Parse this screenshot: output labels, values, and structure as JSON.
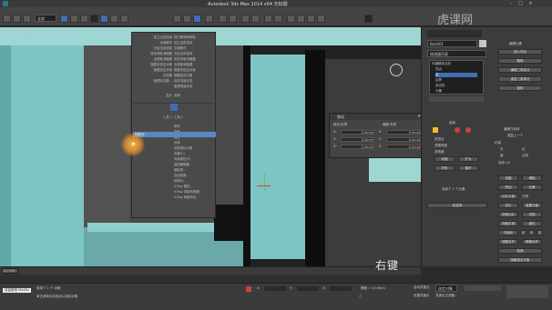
{
  "window": {
    "title": "Autodesk 3ds Max  2014 x64      无标题"
  },
  "toolbar": {
    "selection_filter": "全部"
  },
  "viewport": {
    "label": "[+] [透视] [真实]",
    "gizmo_labels": {
      "x": "x",
      "y": "y",
      "z": "z"
    }
  },
  "context_menu": {
    "top_items": [
      "孤立当前选择",
      "全部解冻",
      "冻结当前选择",
      "按名称取消隐藏",
      "全部取消隐藏",
      "隐藏未选定对象",
      "隐藏选定对象",
      "状态集",
      "管理状态集..."
    ],
    "left_items": [
      "显示",
      "变换",
      "工具 1",
      "工具 2"
    ],
    "right_items": [
      "视口照明和阴影",
      "孤立当前选择",
      "全部解冻",
      "冻结当前选择",
      "按名称取消隐藏",
      "全部取消隐藏",
      "隐藏未选定对象",
      "隐藏选定对象",
      "保存场景状态",
      "管理场景状态"
    ],
    "bottom_items": [
      "移动",
      "旋转",
      "缩放",
      "选择",
      "选择类似对象",
      "克隆(C)",
      "对象属性(P)",
      "曲线编辑器",
      "摄影表...",
      "连线参数...",
      "转换为:",
      "V-Ray 属性",
      "V-Ray 场景转换器",
      "V-Ray 网格导出"
    ],
    "highlighted": "转换为:"
  },
  "dialog": {
    "title": "移动",
    "group_absolute": "绝对:世界",
    "group_offset": "偏移:世界",
    "rows": [
      {
        "axis": "X:",
        "abs": "0.0mm",
        "off": "0.0mm"
      },
      {
        "axis": "Y:",
        "abs": "0.0mm",
        "off": "0.0mm"
      },
      {
        "axis": "Z:",
        "abs": "0.0mm",
        "off": "0.0mm"
      }
    ]
  },
  "command_panel": {
    "object_name": "Box001",
    "modifier_list": "修改器列表",
    "stack": [
      "可编辑多边形",
      "顶点",
      "边",
      "边界",
      "多边形",
      "元素"
    ],
    "selection_title": "选择",
    "soft_selection": "软选择",
    "edit_geometry": "编辑几何体",
    "checkboxes": [
      "按顶点",
      "忽略背面",
      "按角度:",
      "收缩",
      "扩大",
      "环形",
      "循环"
    ],
    "count_label": "选择了 1 个元素",
    "buttons_right": [
      "编辑元素",
      "插入顶点",
      "翻转",
      "编辑三角剖分",
      "重复三角算法",
      "旋转",
      "编辑几何体",
      "重复上一个",
      "约束",
      "无",
      "边",
      "面",
      "法线",
      "保持 UV",
      "创建",
      "塌陷",
      "附加",
      "分离",
      "切片平面",
      "分割",
      "切片",
      "重置平面",
      "快速切片",
      "切割",
      "网格平滑",
      "细化",
      "平面化",
      "X",
      "Y",
      "Z",
      "视图对齐",
      "栅格对齐",
      "松弛",
      "隐藏选定对象",
      "全部取消隐藏",
      "隐藏未选定对象",
      "命名选择:",
      "复制",
      "粘贴",
      "删除孤立顶点",
      "完全交互"
    ]
  },
  "timeline": {
    "frame": "0 / 100"
  },
  "status": {
    "prompt": "选择了 1 个 对象",
    "hint": "单击或单击并拖动以选择对象",
    "coords": {
      "x": "X:",
      "y": "Y:",
      "z": "Z:"
    },
    "grid": "栅格 = 10.0mm",
    "auto_key": "自动关键点",
    "set_key": "设置关键点",
    "selected_label": "选定对象",
    "key_filters": "关键点过滤器...",
    "welcome": "欢迎使用 MAXSc"
  },
  "overlay": {
    "caption": "右键",
    "logo": "虎课网"
  },
  "colors": {
    "teal": "#7ec4c4",
    "menu_highlight": "#5b86c4",
    "accent_yellow": "#f0c030",
    "cursor": "#f0a030"
  }
}
